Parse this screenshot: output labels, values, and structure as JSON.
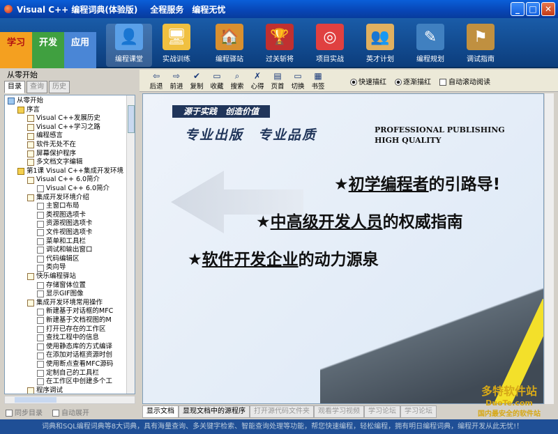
{
  "window": {
    "title": "Visual C++ 编程词典(体验版)",
    "menu": [
      "全程服务",
      "编程无忧"
    ]
  },
  "modes": [
    "学习",
    "开发",
    "应用"
  ],
  "toolbar": [
    {
      "label": "编程课堂",
      "icon": "presenter-icon",
      "color": "#5aa0e8",
      "glyph": "👤"
    },
    {
      "label": "实战训练",
      "icon": "monitor-icon",
      "color": "#f0c040",
      "glyph": "🖥"
    },
    {
      "label": "编程驿站",
      "icon": "house-icon",
      "color": "#d89030",
      "glyph": "🏠"
    },
    {
      "label": "过关斩将",
      "icon": "podium-icon",
      "color": "#c03030",
      "glyph": "🏆"
    },
    {
      "label": "项目实战",
      "icon": "target-icon",
      "color": "#e04040",
      "glyph": "◎"
    },
    {
      "label": "英才计划",
      "icon": "people-icon",
      "color": "#e0b060",
      "glyph": "👥"
    },
    {
      "label": "编程规划",
      "icon": "plan-icon",
      "color": "#4080c0",
      "glyph": "✎"
    },
    {
      "label": "调试指南",
      "icon": "signpost-icon",
      "color": "#c09040",
      "glyph": "⚑"
    }
  ],
  "left": {
    "header": "从零开始",
    "tabs": [
      "目录",
      "查询",
      "历史"
    ],
    "tree": [
      {
        "label": "从零开始",
        "icon": "book-icon",
        "level": 0
      },
      {
        "label": "序言",
        "icon": "folder-icon",
        "level": 1
      },
      {
        "label": "Visual C++发展历史",
        "icon": "doc-icon",
        "level": 2
      },
      {
        "label": "Visual C++学习之路",
        "icon": "doc-icon",
        "level": 2
      },
      {
        "label": "编程感言",
        "icon": "doc-icon",
        "level": 2
      },
      {
        "label": "软件无处不在",
        "icon": "doc-icon",
        "level": 2
      },
      {
        "label": "屏幕保护程序",
        "icon": "doc-icon",
        "level": 2
      },
      {
        "label": "多文档文字编辑",
        "icon": "doc-icon",
        "level": 2
      },
      {
        "label": "第1课 Visual C++集成开发环境",
        "icon": "folder-icon",
        "level": 1
      },
      {
        "label": "Visual C++ 6.0简介",
        "icon": "doc-icon",
        "level": 2
      },
      {
        "label": "Visual C++ 6.0简介",
        "icon": "page-icon",
        "level": 3
      },
      {
        "label": "集成开发环境介绍",
        "icon": "doc-icon",
        "level": 2
      },
      {
        "label": "主窗口布局",
        "icon": "page-icon",
        "level": 3
      },
      {
        "label": "类视图选项卡",
        "icon": "page-icon",
        "level": 3
      },
      {
        "label": "资源视图选项卡",
        "icon": "page-icon",
        "level": 3
      },
      {
        "label": "文件视图选项卡",
        "icon": "page-icon",
        "level": 3
      },
      {
        "label": "菜单和工具栏",
        "icon": "page-icon",
        "level": 3
      },
      {
        "label": "调试和输出窗口",
        "icon": "page-icon",
        "level": 3
      },
      {
        "label": "代码编辑区",
        "icon": "page-icon",
        "level": 3
      },
      {
        "label": "类向导",
        "icon": "page-icon",
        "level": 3
      },
      {
        "label": "快乐编程驿站",
        "icon": "doc-icon",
        "level": 2
      },
      {
        "label": "存储窗体位置",
        "icon": "page-icon",
        "level": 3
      },
      {
        "label": "显示GIF图像",
        "icon": "page-icon",
        "level": 3
      },
      {
        "label": "集成开发环境常用操作",
        "icon": "doc-icon",
        "level": 2
      },
      {
        "label": "新建基于对话框的MFC",
        "icon": "page-icon",
        "level": 3
      },
      {
        "label": "新建基于文档视图的M",
        "icon": "page-icon",
        "level": 3
      },
      {
        "label": "打开已存在的工作区",
        "icon": "page-icon",
        "level": 3
      },
      {
        "label": "查找工程中的信息",
        "icon": "page-icon",
        "level": 3
      },
      {
        "label": "使用静态库的方式编译",
        "icon": "page-icon",
        "level": 3
      },
      {
        "label": "在添加对话框资源时创",
        "icon": "page-icon",
        "level": 3
      },
      {
        "label": "使用断点查看MFC源码",
        "icon": "page-icon",
        "level": 3
      },
      {
        "label": "定制自己的工具栏",
        "icon": "page-icon",
        "level": 3
      },
      {
        "label": "在工作区中创建多个工",
        "icon": "page-icon",
        "level": 3
      },
      {
        "label": "程序调试",
        "icon": "doc-icon",
        "level": 2
      }
    ],
    "checks": [
      "同步目录",
      "自动展开"
    ]
  },
  "readbar": {
    "buttons": [
      {
        "label": "后退",
        "glyph": "⇦",
        "icon": "back-icon"
      },
      {
        "label": "前进",
        "glyph": "⇨",
        "icon": "forward-icon"
      },
      {
        "label": "复制",
        "glyph": "✔",
        "icon": "copy-icon"
      },
      {
        "label": "收藏",
        "glyph": "▭",
        "icon": "bookmark-icon"
      },
      {
        "label": "搜索",
        "glyph": "⌕",
        "icon": "search-icon"
      },
      {
        "label": "心得",
        "glyph": "✗",
        "icon": "notes-icon"
      },
      {
        "label": "页首",
        "glyph": "▤",
        "icon": "pagetop-icon"
      },
      {
        "label": "切换",
        "glyph": "▭",
        "icon": "switch-icon"
      },
      {
        "label": "书签",
        "glyph": "▦",
        "icon": "bookmarks-icon"
      }
    ],
    "radio_fast": "快速描红",
    "radio_slow": "逐渐描红",
    "auto_scroll": "自动滚动阅读"
  },
  "content": {
    "slogan": "源于实践　创造价值",
    "pro_cn": "专业出版　专业品质",
    "pro_en1": "PROFESSIONAL PUBLISHING",
    "pro_en2": "HIGH QUALITY",
    "line1_pre": "★",
    "line1_u": "初学编程者",
    "line1_post": "的引路导!",
    "line2_pre": "★",
    "line2_u": "中高级开发人员",
    "line2_post": "的权威指南",
    "line3_pre": "★",
    "line3_u": "软件开发企业",
    "line3_post": "的动力源泉"
  },
  "bottomtabs": [
    {
      "label": "显示文档",
      "state": "active"
    },
    {
      "label": "显现文档中的源程序",
      "state": "normal"
    },
    {
      "label": "打开源代码文件夹",
      "state": "dim"
    },
    {
      "label": "观看学习视频",
      "state": "dim"
    },
    {
      "label": "学习论坛",
      "state": "dim"
    },
    {
      "label": "学习论坛",
      "state": "dim"
    }
  ],
  "status": "词典和SQL编程词典等8大词典，具有海量查询、多关键字检索、智能查询处理等功能，帮您快速编程，轻松编程，拥有明日编程词典，编程开发从此无忧!！",
  "watermark": {
    "line1": "多特软件站",
    "line2": "DuoTe.com",
    "line3": "国内最安全的软件站"
  }
}
